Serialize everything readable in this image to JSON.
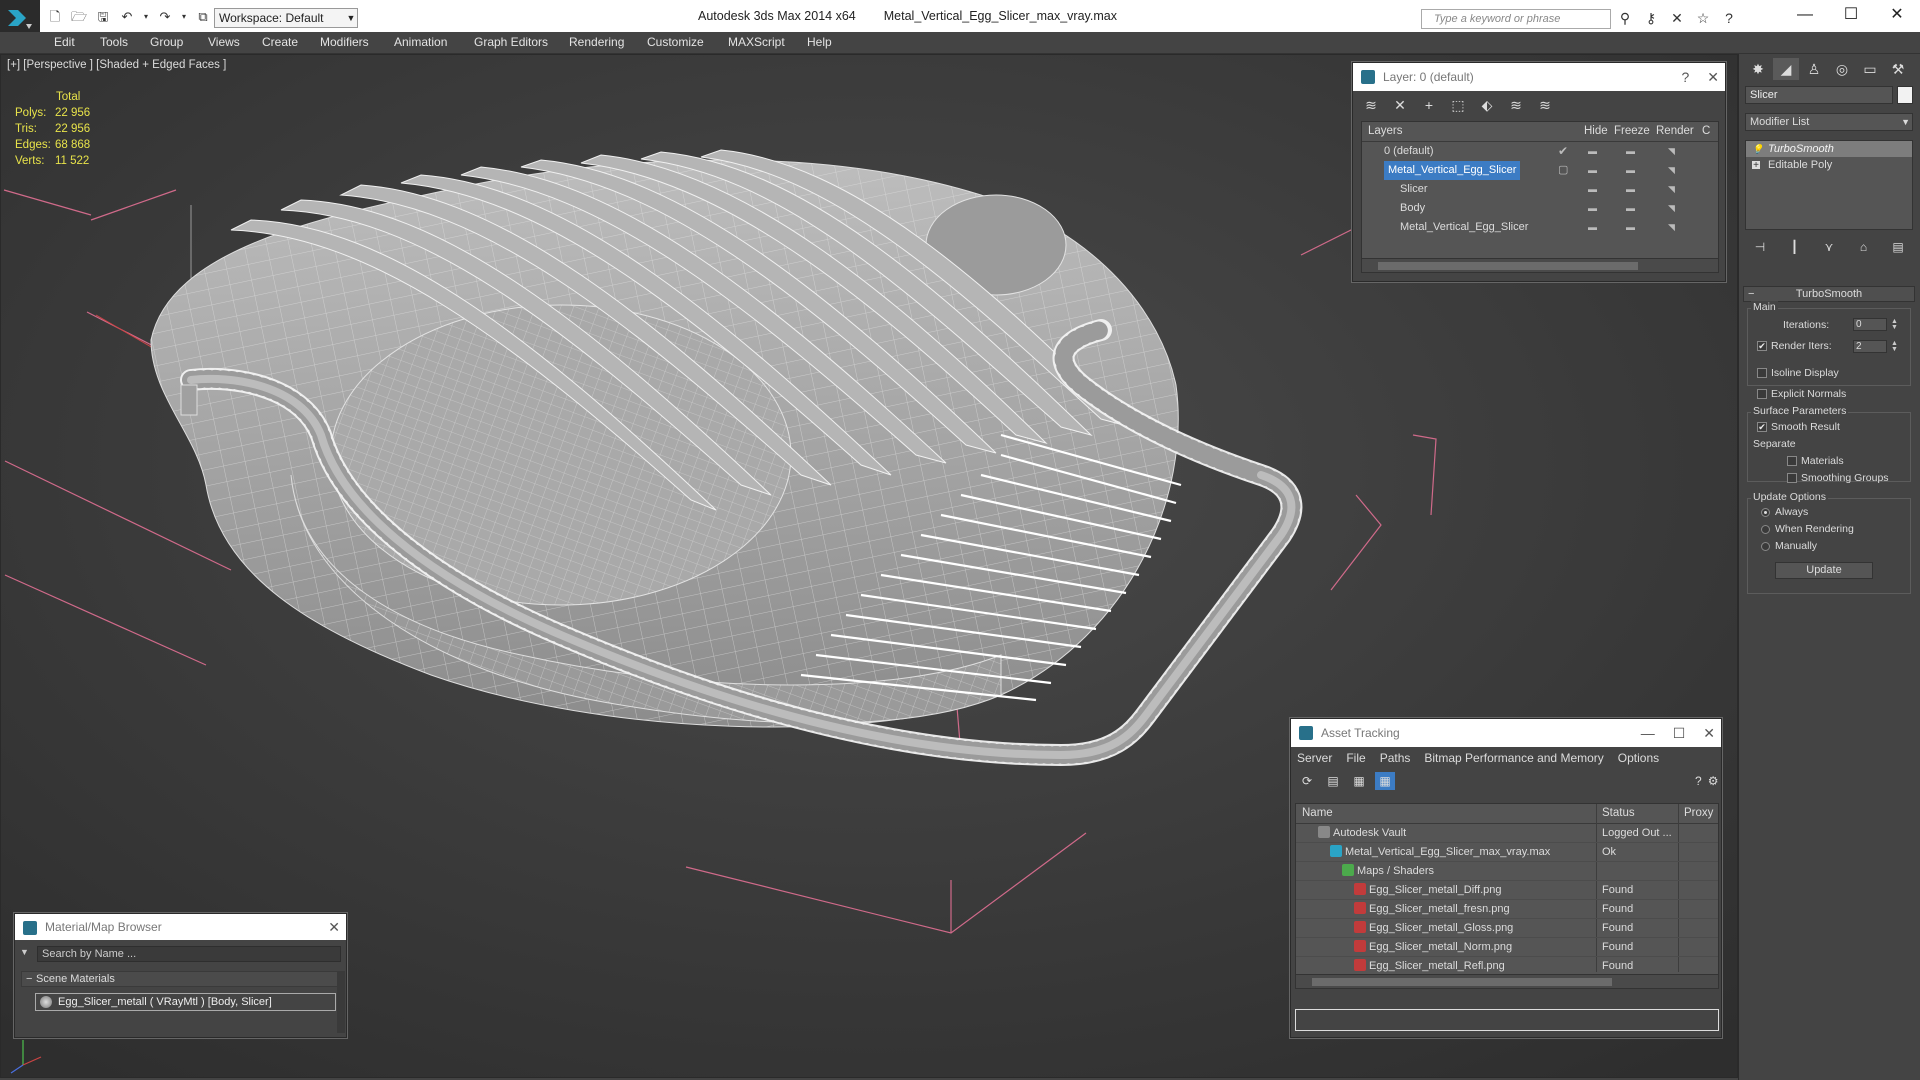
{
  "app": {
    "title": "Autodesk 3ds Max  2014 x64",
    "file": "Metal_Vertical_Egg_Slicer_max_vray.max",
    "workspace": "Workspace: Default",
    "search_placeholder": "Type a keyword or phrase"
  },
  "menu": [
    "Edit",
    "Tools",
    "Group",
    "Views",
    "Create",
    "Modifiers",
    "Animation",
    "Graph Editors",
    "Rendering",
    "Customize",
    "MAXScript",
    "Help"
  ],
  "viewport": {
    "label": "[+] [Perspective ] [Shaded + Edged Faces ]",
    "stats": {
      "header": "Total",
      "rows": [
        {
          "key": "Polys:",
          "value": "22 956"
        },
        {
          "key": "Tris:",
          "value": "22 956"
        },
        {
          "key": "Edges:",
          "value": "68 868"
        },
        {
          "key": "Verts:",
          "value": "11 522"
        }
      ]
    }
  },
  "layer_window": {
    "title": "Layer: 0 (default)",
    "columns": [
      "Layers",
      "Hide",
      "Freeze",
      "Render",
      "C"
    ],
    "rows": [
      {
        "name": "0 (default)"
      },
      {
        "name": "Metal_Vertical_Egg_Slicer"
      },
      {
        "name": "Slicer"
      },
      {
        "name": "Body"
      },
      {
        "name": "Metal_Vertical_Egg_Slicer"
      }
    ]
  },
  "command_panel": {
    "object_name": "Slicer",
    "modifier_list": "Modifier List",
    "stack": [
      "TurboSmooth",
      "Editable Poly"
    ],
    "turbosmooth": {
      "title": "TurboSmooth",
      "main_label": "Main",
      "iterations_label": "Iterations:",
      "iterations_value": "0",
      "render_iters_label": "Render Iters:",
      "render_iters_value": "2",
      "render_iters_checked": true,
      "isoline_label": "Isoline Display",
      "explicit_normals_label": "Explicit Normals",
      "surface_label": "Surface Parameters",
      "smooth_result_label": "Smooth Result",
      "separate_label": "Separate",
      "materials_label": "Materials",
      "smoothing_groups_label": "Smoothing Groups",
      "update_options_label": "Update Options",
      "always_label": "Always",
      "when_rendering_label": "When Rendering",
      "manually_label": "Manually",
      "update_button": "Update"
    }
  },
  "material_browser": {
    "title": "Material/Map Browser",
    "search_placeholder": "Search by Name ...",
    "section": "Scene Materials",
    "material": "Egg_Slicer_metall  ( VRayMtl ) [Body, Slicer]"
  },
  "asset_tracking": {
    "title": "Asset Tracking",
    "menu": [
      "Server",
      "File",
      "Paths",
      "Bitmap Performance and Memory",
      "Options"
    ],
    "columns": [
      "Name",
      "Status",
      "Proxy"
    ],
    "rows": [
      {
        "name": "Autodesk Vault",
        "status": "Logged Out ..."
      },
      {
        "name": "Metal_Vertical_Egg_Slicer_max_vray.max",
        "status": "Ok"
      },
      {
        "name": "Maps / Shaders",
        "status": ""
      },
      {
        "name": "Egg_Slicer_metall_Diff.png",
        "status": "Found"
      },
      {
        "name": "Egg_Slicer_metall_fresn.png",
        "status": "Found"
      },
      {
        "name": "Egg_Slicer_metall_Gloss.png",
        "status": "Found"
      },
      {
        "name": "Egg_Slicer_metall_Norm.png",
        "status": "Found"
      },
      {
        "name": "Egg_Slicer_metall_Refl.png",
        "status": "Found"
      }
    ]
  },
  "colors": {
    "stats": "#e8e34a",
    "selection": "#3c7cc4",
    "viewport_bg": "#3b3b3b",
    "panel_bg": "#444444"
  }
}
